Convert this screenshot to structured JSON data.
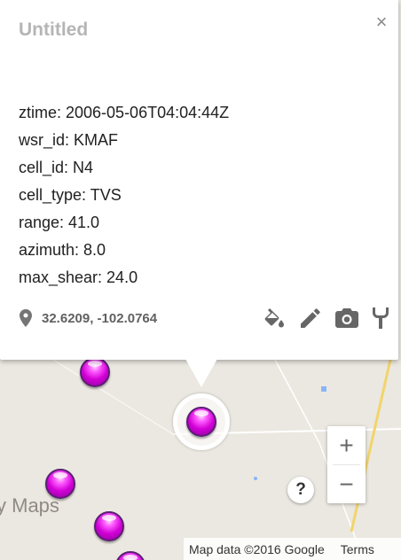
{
  "popup": {
    "title": "Untitled",
    "close_icon": "×",
    "attributes": [
      "ztime: 2006-05-06T04:04:44Z",
      "wsr_id: KMAF",
      "cell_id: N4",
      "cell_type: TVS",
      "range: 41.0",
      "azimuth: 8.0",
      "max_shear: 24.0"
    ],
    "coordinates": "32.6209, -102.0764",
    "actions": [
      "paint-bucket-icon",
      "pencil-icon",
      "camera-icon",
      "tuning-fork-icon"
    ]
  },
  "map": {
    "watermark": "y Maps",
    "zoom_in": "+",
    "zoom_out": "−",
    "help": "?",
    "attribution": "Map data ©2016 Google",
    "terms": "Terms",
    "marker_color": "#d200d6",
    "water_color": "#8ab4f8"
  }
}
